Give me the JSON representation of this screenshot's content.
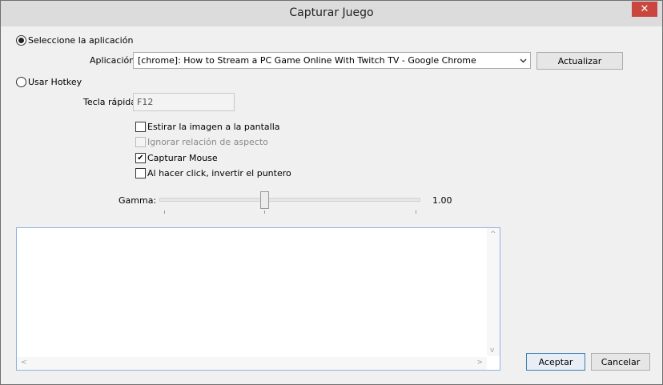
{
  "window": {
    "title": "Capturar Juego",
    "close_glyph": "✕"
  },
  "mode": {
    "select_app_label": "Seleccione la aplicación",
    "use_hotkey_label": "Usar Hotkey",
    "selected": "select_app"
  },
  "application": {
    "label": "Aplicación:",
    "value": "[chrome]: How to Stream a PC Game Online With Twitch TV - Google Chrome",
    "refresh_label": "Actualizar"
  },
  "hotkey": {
    "label": "Tecla rápida",
    "value": "F12"
  },
  "options": [
    {
      "label": "Estirar la imagen a la pantalla",
      "checked": false,
      "enabled": true
    },
    {
      "label": "Ignorar relación de aspecto",
      "checked": false,
      "enabled": false
    },
    {
      "label": "Capturar Mouse",
      "checked": true,
      "enabled": true
    },
    {
      "label": "Al hacer click, invertir el puntero",
      "checked": false,
      "enabled": true
    }
  ],
  "gamma": {
    "label": "Gamma:",
    "value_text": "1.00",
    "value": 1.0
  },
  "footer": {
    "accept_label": "Aceptar",
    "cancel_label": "Cancelar"
  },
  "icons": {
    "check": "✔",
    "chevron_down": "⌄",
    "scroll_up": "^",
    "scroll_down": "v",
    "scroll_left": "<",
    "scroll_right": ">"
  }
}
